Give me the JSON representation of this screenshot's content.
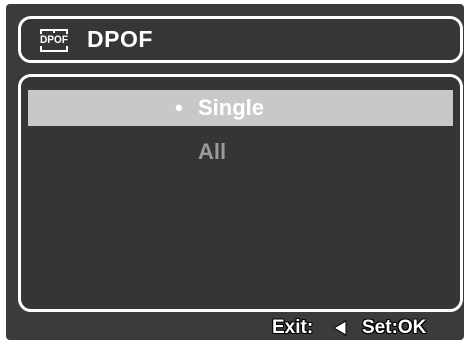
{
  "header": {
    "icon": "dpof-print-icon",
    "icon_text": "DPOF",
    "title": "DPOF"
  },
  "menu": {
    "options": [
      {
        "label": "Single",
        "selected": true
      },
      {
        "label": "All",
        "selected": false
      }
    ],
    "selected_bullet": "•"
  },
  "footer": {
    "exit_label": "Exit:",
    "exit_icon": "left-arrow-icon",
    "set_label": "Set:OK"
  },
  "colors": {
    "background": "#3b3b3b",
    "highlight": "#c8c8c8",
    "text": "#ffffff",
    "dim_text": "#9a9a9a",
    "border": "#ffffff"
  }
}
